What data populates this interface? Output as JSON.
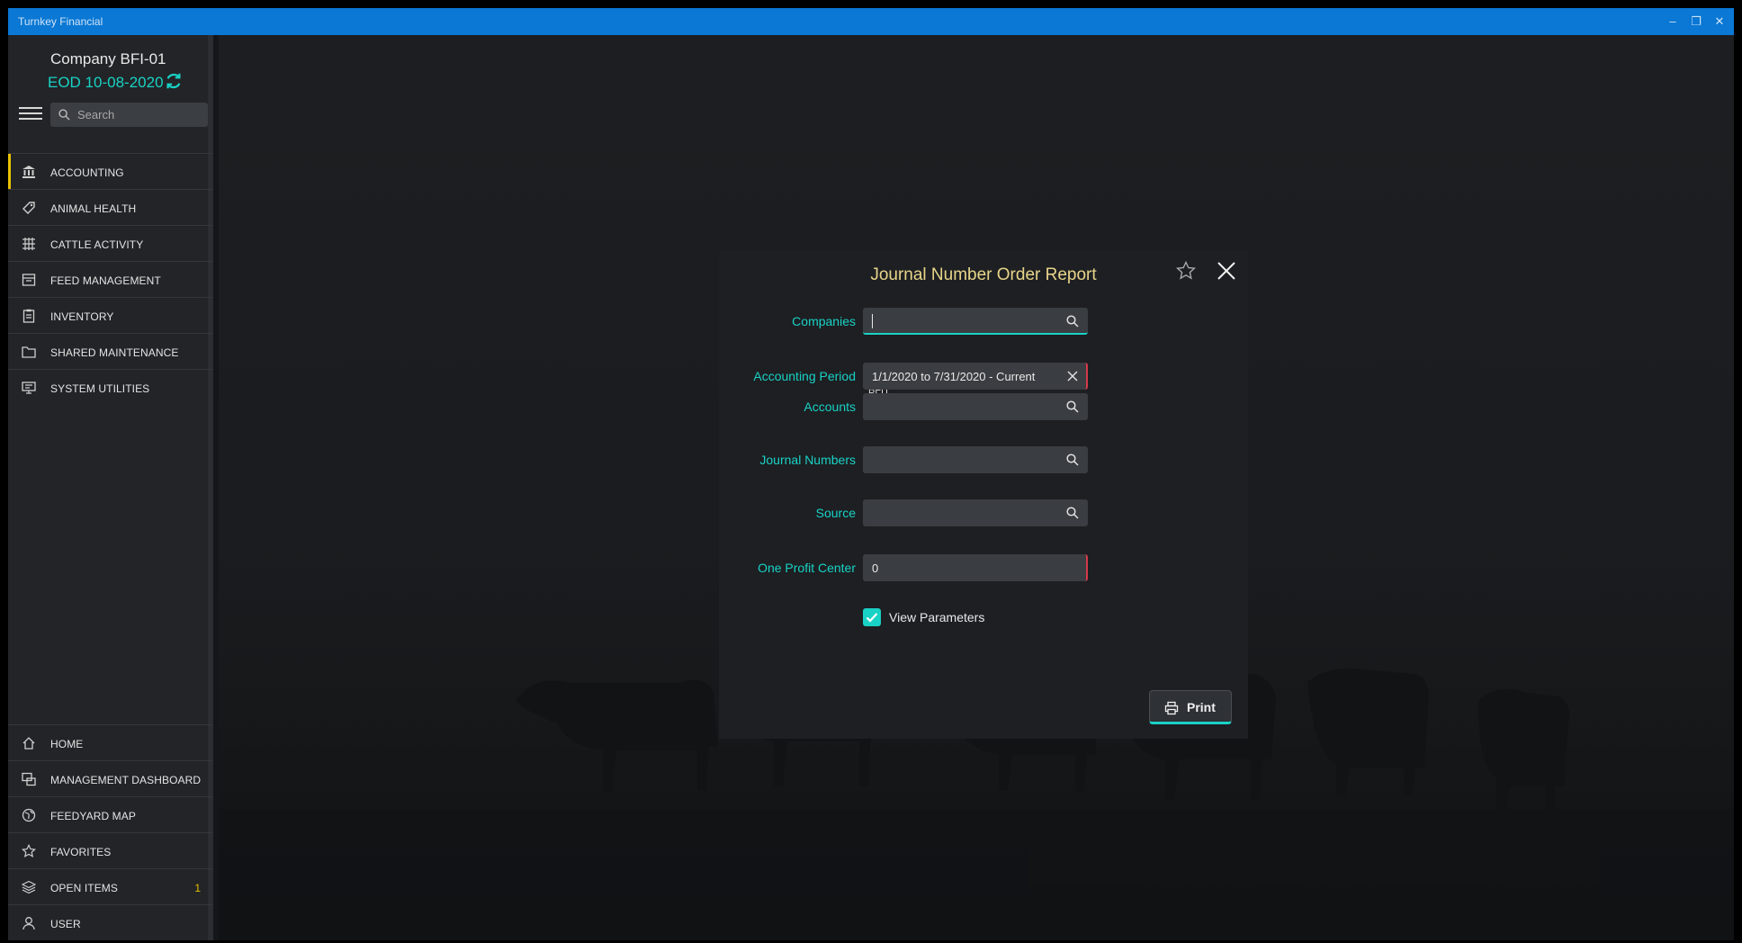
{
  "window": {
    "title": "Turnkey Financial",
    "minimize": "–",
    "restore": "❐",
    "close": "✕"
  },
  "sidebar": {
    "company": "Company BFI-01",
    "eod": "EOD  10-08-2020",
    "search_placeholder": "Search",
    "top_items": [
      {
        "label": "ACCOUNTING",
        "icon": "bank-icon"
      },
      {
        "label": "ANIMAL HEALTH",
        "icon": "tag-icon"
      },
      {
        "label": "CATTLE ACTIVITY",
        "icon": "grid-icon"
      },
      {
        "label": "FEED MANAGEMENT",
        "icon": "feed-icon"
      },
      {
        "label": "INVENTORY",
        "icon": "clipboard-icon"
      },
      {
        "label": "SHARED MAINTENANCE",
        "icon": "folder-icon"
      },
      {
        "label": "SYSTEM UTILITIES",
        "icon": "monitor-icon"
      }
    ],
    "bottom_items": [
      {
        "label": "HOME",
        "icon": "home-icon"
      },
      {
        "label": "MANAGEMENT DASHBOARD",
        "icon": "dashboard-icon"
      },
      {
        "label": "FEEDYARD MAP",
        "icon": "globe-icon"
      },
      {
        "label": "FAVORITES",
        "icon": "star-icon"
      },
      {
        "label": "OPEN ITEMS",
        "icon": "layers-icon",
        "badge": "1"
      },
      {
        "label": "USER",
        "icon": "user-icon"
      }
    ]
  },
  "dialog": {
    "title": "Journal Number Order Report",
    "fields": {
      "companies": {
        "label": "Companies",
        "value": ""
      },
      "companies_chip": "BFI",
      "accounting_period": {
        "label": "Accounting Period",
        "value": "1/1/2020 to 7/31/2020 - Current"
      },
      "accounts": {
        "label": "Accounts",
        "value": ""
      },
      "journal_numbers": {
        "label": "Journal Numbers",
        "value": ""
      },
      "source": {
        "label": "Source",
        "value": ""
      },
      "one_profit_center": {
        "label": "One Profit Center",
        "value": "0"
      }
    },
    "view_parameters": {
      "label": "View Parameters",
      "checked": true
    },
    "print_label": "Print"
  },
  "colors": {
    "accent": "#19d2c6",
    "title_gold": "#e8d58a",
    "titlebar": "#0a78d4",
    "active_indicator": "#e8c200",
    "error": "#d33a4a"
  }
}
